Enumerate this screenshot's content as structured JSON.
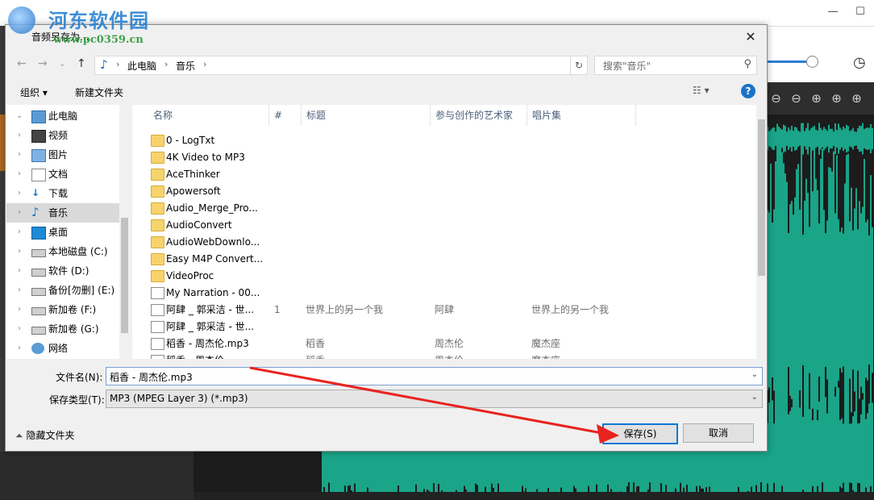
{
  "dialog": {
    "title": "音频另存为...",
    "close_icon": "✕"
  },
  "watermark": {
    "name": "河东软件园",
    "url": "www.pc0359.cn"
  },
  "address": {
    "crumbs": [
      "此电脑",
      "音乐"
    ],
    "search_placeholder": "搜索\"音乐\""
  },
  "toolbar": {
    "organize_label": "组织 ▾",
    "new_folder_label": "新建文件夹",
    "help_label": "?"
  },
  "nav": {
    "items": [
      {
        "label": "此电脑",
        "icon": "computer-icon"
      },
      {
        "label": "视频",
        "icon": "video-icon"
      },
      {
        "label": "图片",
        "icon": "picture-icon"
      },
      {
        "label": "文档",
        "icon": "document-icon"
      },
      {
        "label": "下载",
        "icon": "download-icon"
      },
      {
        "label": "音乐",
        "icon": "music-icon"
      },
      {
        "label": "桌面",
        "icon": "desktop-icon"
      },
      {
        "label": "本地磁盘 (C:)",
        "icon": "drive-icon"
      },
      {
        "label": "软件 (D:)",
        "icon": "drive-icon"
      },
      {
        "label": "备份[勿删] (E:)",
        "icon": "drive-icon"
      },
      {
        "label": "新加卷 (F:)",
        "icon": "drive-icon"
      },
      {
        "label": "新加卷 (G:)",
        "icon": "drive-icon"
      },
      {
        "label": "网络",
        "icon": "network-icon"
      }
    ]
  },
  "columns": [
    "名称",
    "#",
    "标题",
    "参与创作的艺术家",
    "唱片集"
  ],
  "files": [
    {
      "name": "0 - LogTxt",
      "type": "folder",
      "num": "",
      "title": "",
      "artist": "",
      "album": ""
    },
    {
      "name": "4K Video to MP3",
      "type": "folder",
      "num": "",
      "title": "",
      "artist": "",
      "album": ""
    },
    {
      "name": "AceThinker",
      "type": "folder",
      "num": "",
      "title": "",
      "artist": "",
      "album": ""
    },
    {
      "name": "Apowersoft",
      "type": "folder",
      "num": "",
      "title": "",
      "artist": "",
      "album": ""
    },
    {
      "name": "Audio_Merge_Pro...",
      "type": "folder",
      "num": "",
      "title": "",
      "artist": "",
      "album": ""
    },
    {
      "name": "AudioConvert",
      "type": "folder",
      "num": "",
      "title": "",
      "artist": "",
      "album": ""
    },
    {
      "name": "AudioWebDownlo...",
      "type": "folder",
      "num": "",
      "title": "",
      "artist": "",
      "album": ""
    },
    {
      "name": "Easy M4P Convert...",
      "type": "folder",
      "num": "",
      "title": "",
      "artist": "",
      "album": ""
    },
    {
      "name": "VideoProc",
      "type": "folder",
      "num": "",
      "title": "",
      "artist": "",
      "album": ""
    },
    {
      "name": "My Narration - 00...",
      "type": "audio",
      "num": "",
      "title": "",
      "artist": "",
      "album": ""
    },
    {
      "name": "阿肆 _ 郭采洁 - 世...",
      "type": "audio",
      "num": "1",
      "title": "世界上的另一个我",
      "artist": "阿肆",
      "album": "世界上的另一个我"
    },
    {
      "name": "阿肆 _ 郭采洁 - 世...",
      "type": "audio",
      "num": "",
      "title": "",
      "artist": "",
      "album": ""
    },
    {
      "name": "稻香 - 周杰伦.mp3",
      "type": "audio",
      "num": "",
      "title": "稻香",
      "artist": "周杰伦",
      "album": "魔杰座"
    },
    {
      "name": "稻香 - 周杰伦",
      "type": "audio",
      "num": "",
      "title": "稻香",
      "artist": "周杰伦",
      "album": "魔杰座"
    }
  ],
  "form": {
    "filename_label": "文件名(N):",
    "filename_value": "稻香 - 周杰伦.mp3",
    "filetype_label": "保存类型(T):",
    "filetype_value": "MP3 (MPEG Layer 3) (*.mp3)",
    "hide_folders_label": "隐藏文件夹",
    "save_label": "保存(S)",
    "cancel_label": "取消"
  },
  "colors": {
    "accent": "#0078d7",
    "waveform": "#1aa488",
    "arrow": "#e8231f"
  }
}
